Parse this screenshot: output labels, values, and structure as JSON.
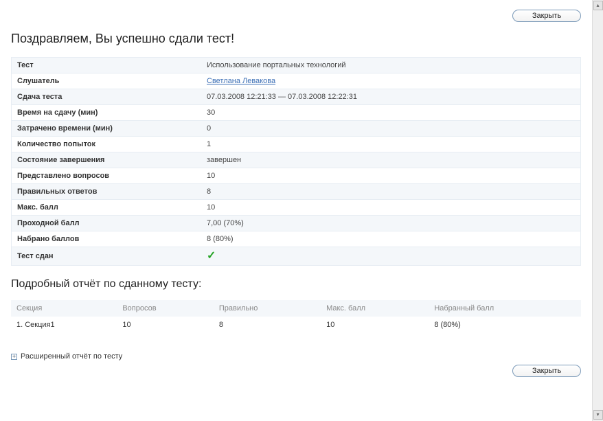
{
  "buttons": {
    "close_top": "Закрыть",
    "close_bottom": "Закрыть"
  },
  "headings": {
    "main": "Поздравляем, Вы успешно сдали тест!",
    "detail": "Подробный отчёт по сданному тесту:"
  },
  "info_rows": {
    "test_label": "Тест",
    "test_value": "Использование портальных технологий",
    "listener_label": "Слушатель",
    "listener_value": "Светлана Левакова",
    "submission_label": "Сдача теста",
    "submission_value": "07.03.2008 12:21:33 — 07.03.2008 12:22:31",
    "time_limit_label": "Время на сдачу (мин)",
    "time_limit_value": "30",
    "time_spent_label": "Затрачено времени (мин)",
    "time_spent_value": "0",
    "attempts_label": "Количество попыток",
    "attempts_value": "1",
    "completion_label": "Состояние завершения",
    "completion_value": "завершен",
    "questions_label": "Представлено вопросов",
    "questions_value": "10",
    "correct_label": "Правильных ответов",
    "correct_value": "8",
    "max_score_label": "Макс. балл",
    "max_score_value": "10",
    "passing_label": "Проходной балл",
    "passing_value": "7,00 (70%)",
    "scored_label": "Набрано баллов",
    "scored_value": "8 (80%)",
    "passed_label": "Тест сдан"
  },
  "detail_table": {
    "headers": {
      "section": "Секция",
      "questions": "Вопросов",
      "correct": "Правильно",
      "max": "Макс. балл",
      "scored": "Набранный балл"
    },
    "rows": [
      {
        "section": "1. Секция1",
        "questions": "10",
        "correct": "8",
        "max": "10",
        "scored": "8 (80%)"
      }
    ]
  },
  "expand": {
    "label": "Расширенный отчёт по тесту",
    "symbol": "+"
  },
  "icons": {
    "check": "✓",
    "scroll_up": "▴",
    "scroll_down": "▾"
  }
}
